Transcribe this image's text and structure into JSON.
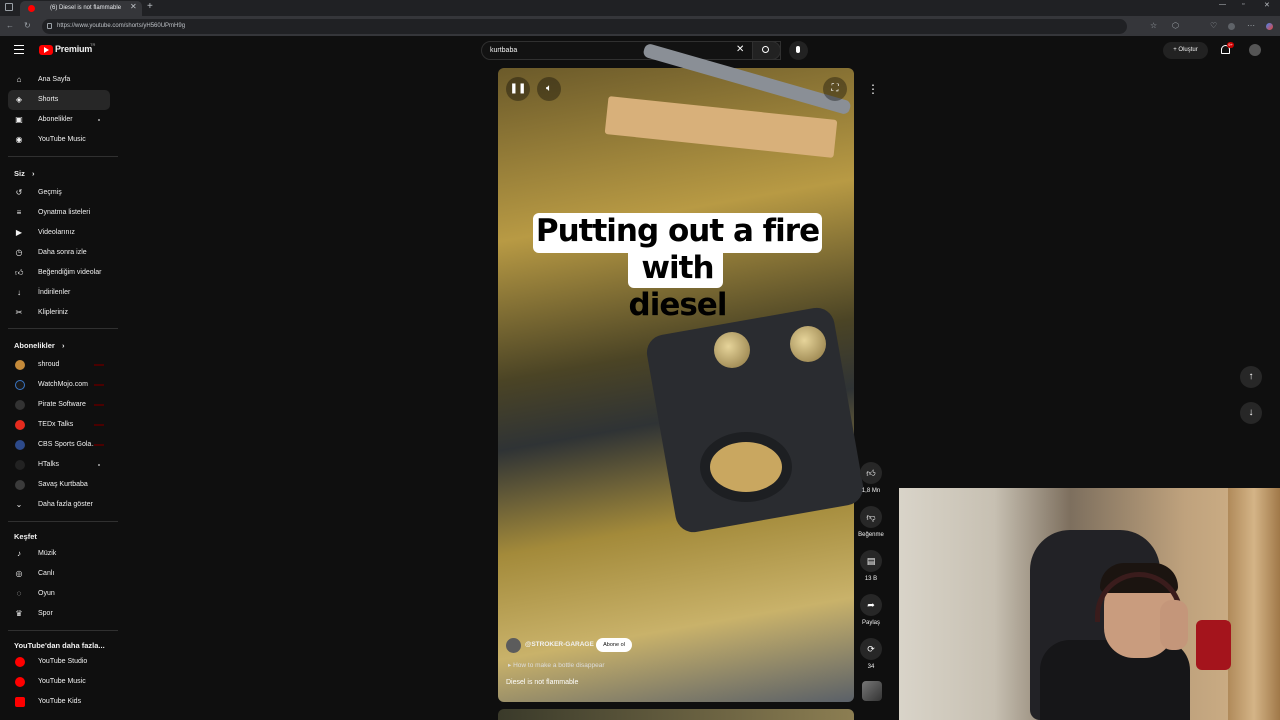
{
  "browser": {
    "tab_title": "(6) Diesel is not flammable",
    "url": "https://www.youtube.com/shorts/yH560UPmH9g"
  },
  "header": {
    "logo_text": "Premium",
    "logo_tr": "TR",
    "search_value": "kurtbaba",
    "create_label": "Oluştur",
    "notification_count": "9+"
  },
  "sidebar": {
    "main": [
      {
        "label": "Ana Sayfa",
        "icon": "home-icon"
      },
      {
        "label": "Shorts",
        "icon": "shorts-icon"
      },
      {
        "label": "Abonelikler",
        "icon": "subscriptions-icon"
      },
      {
        "label": "YouTube Music",
        "icon": "music-icon"
      }
    ],
    "you_heading": "Siz",
    "you": [
      {
        "label": "Geçmiş",
        "icon": "history-icon"
      },
      {
        "label": "Oynatma listeleri",
        "icon": "playlists-icon"
      },
      {
        "label": "Videolarınız",
        "icon": "your-videos-icon"
      },
      {
        "label": "Daha sonra izle",
        "icon": "watch-later-icon"
      },
      {
        "label": "Beğendiğim videolar",
        "icon": "liked-icon"
      },
      {
        "label": "İndirilenler",
        "icon": "download-icon"
      },
      {
        "label": "Klipleriniz",
        "icon": "clips-icon"
      }
    ],
    "subs_heading": "Abonelikler",
    "subs": [
      {
        "label": "shroud",
        "color": "#c48a3a"
      },
      {
        "label": "WatchMojo.com",
        "color": "#1a1a1a"
      },
      {
        "label": "Pirate Software",
        "color": "#333333"
      },
      {
        "label": "TEDx Talks",
        "color": "#e62b1e"
      },
      {
        "label": "CBS Sports Gola...",
        "color": "#2d4a8a"
      },
      {
        "label": "HTalks",
        "color": "#222222"
      },
      {
        "label": "Savaş Kurtbaba",
        "color": "#3b3b3b"
      }
    ],
    "show_more": "Daha fazla göster",
    "explore_heading": "Keşfet",
    "explore": [
      {
        "label": "Müzik",
        "icon": "music-note-icon"
      },
      {
        "label": "Canlı",
        "icon": "live-icon"
      },
      {
        "label": "Oyun",
        "icon": "gaming-icon"
      },
      {
        "label": "Spor",
        "icon": "trophy-icon"
      }
    ],
    "more_heading": "YouTube'dan daha fazla...",
    "more": [
      {
        "label": "YouTube Studio",
        "color": "#ff0000"
      },
      {
        "label": "YouTube Music",
        "color": "#ff0000"
      },
      {
        "label": "YouTube Kids",
        "color": "#ff0000"
      }
    ]
  },
  "video": {
    "caption_line1": "Putting out a fire with",
    "caption_line2": "diesel",
    "channel": "@STROKER-GARAGE",
    "subscribe_label": "Abone ol",
    "related": "How to make a bottle disappear",
    "title": "Diesel is not flammable"
  },
  "actions": {
    "likes": "1,8 Mn",
    "dislike_label": "Beğenme",
    "comments": "13 B",
    "share_label": "Paylaş",
    "remix_count": "34"
  }
}
